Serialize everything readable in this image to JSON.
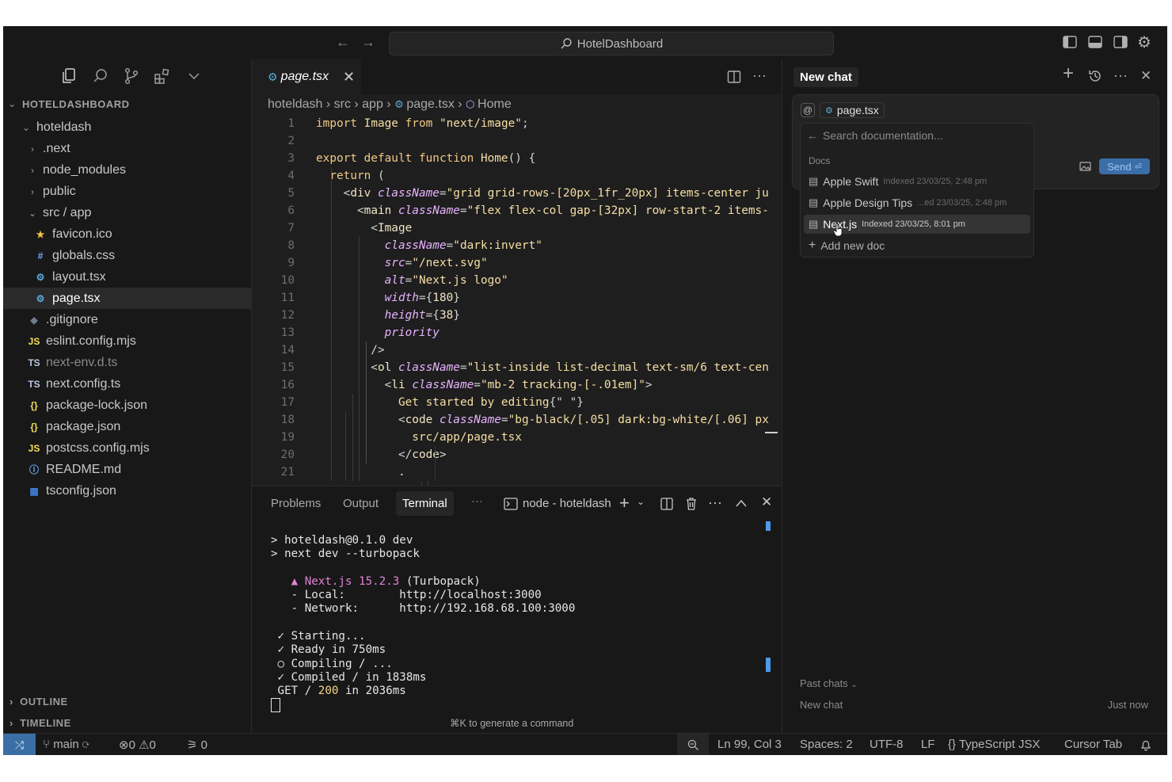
{
  "titlebar": {
    "search_label": "HotelDashboard",
    "back_icon": "arrow-left-icon",
    "forward_icon": "arrow-right-icon"
  },
  "sidebar": {
    "root_label": "HOTELDASHBOARD",
    "tree": [
      {
        "label": "hoteldash",
        "type": "folder-open",
        "indent": 1
      },
      {
        "label": ".next",
        "type": "folder",
        "indent": 2
      },
      {
        "label": "node_modules",
        "type": "folder",
        "indent": 2
      },
      {
        "label": "public",
        "type": "folder",
        "indent": 2
      },
      {
        "label": "src / app",
        "type": "folder-open",
        "indent": 2
      },
      {
        "label": "favicon.ico",
        "icon": "★",
        "color": "#f5c542",
        "indent": 3
      },
      {
        "label": "globals.css",
        "icon": "#",
        "color": "#6fb0ff",
        "indent": 3
      },
      {
        "label": "layout.tsx",
        "icon": "⚙",
        "color": "#5fa8d3",
        "indent": 3
      },
      {
        "label": "page.tsx",
        "icon": "⚙",
        "color": "#5fa8d3",
        "indent": 3,
        "selected": true
      },
      {
        "label": ".gitignore",
        "icon": "◆",
        "color": "#6e7b8a",
        "indent": 2
      },
      {
        "label": "eslint.config.mjs",
        "icon": "JS",
        "color": "#f5de5a",
        "indent": 2
      },
      {
        "label": "next-env.d.ts",
        "icon": "TS",
        "color": "#b8c7e0",
        "indent": 2,
        "dim": true
      },
      {
        "label": "next.config.ts",
        "icon": "TS",
        "color": "#b8c7e0",
        "indent": 2
      },
      {
        "label": "package-lock.json",
        "icon": "{}",
        "color": "#f5de5a",
        "indent": 2
      },
      {
        "label": "package.json",
        "icon": "{}",
        "color": "#f5de5a",
        "indent": 2
      },
      {
        "label": "postcss.config.mjs",
        "icon": "JS",
        "color": "#f5de5a",
        "indent": 2
      },
      {
        "label": "README.md",
        "icon": "ⓘ",
        "color": "#6fb0ff",
        "indent": 2
      },
      {
        "label": "tsconfig.json",
        "icon": "▦",
        "color": "#3f7fd8",
        "indent": 2
      }
    ],
    "outline_label": "OUTLINE",
    "timeline_label": "TIMELINE"
  },
  "editor": {
    "tab_label": "page.tsx",
    "breadcrumb": [
      "hoteldash",
      "src",
      "app",
      "page.tsx",
      "Home"
    ],
    "lines": [
      [
        [
          "kw",
          "import "
        ],
        [
          "fn",
          "Image "
        ],
        [
          "kw",
          "from "
        ],
        [
          "str",
          "\"next/image\""
        ],
        [
          "punc",
          ";"
        ]
      ],
      [],
      [
        [
          "kw",
          "export default function "
        ],
        [
          "fn",
          "Home"
        ],
        [
          "punc",
          "() {"
        ]
      ],
      [
        [
          "kw",
          "  return "
        ],
        [
          "punc",
          "("
        ]
      ],
      [
        [
          "punc",
          "    <"
        ],
        [
          "tag",
          "div "
        ],
        [
          "attr",
          "className"
        ],
        [
          "punc",
          "="
        ],
        [
          "str",
          "\"grid grid-rows-[20px_1fr_20px] items-center ju"
        ]
      ],
      [
        [
          "punc",
          "      <"
        ],
        [
          "tag",
          "main "
        ],
        [
          "attr",
          "className"
        ],
        [
          "punc",
          "="
        ],
        [
          "str",
          "\"flex flex-col gap-[32px] row-start-2 items-"
        ]
      ],
      [
        [
          "punc",
          "        <"
        ],
        [
          "tag",
          "Image"
        ]
      ],
      [
        [
          "attr",
          "          className"
        ],
        [
          "punc",
          "="
        ],
        [
          "str",
          "\"dark:invert\""
        ]
      ],
      [
        [
          "attr",
          "          src"
        ],
        [
          "punc",
          "="
        ],
        [
          "str",
          "\"/next.svg\""
        ]
      ],
      [
        [
          "attr",
          "          alt"
        ],
        [
          "punc",
          "="
        ],
        [
          "str",
          "\"Next.js logo\""
        ]
      ],
      [
        [
          "attr",
          "          width"
        ],
        [
          "punc",
          "={"
        ],
        [
          "num",
          "180"
        ],
        [
          "punc",
          "}"
        ]
      ],
      [
        [
          "attr",
          "          height"
        ],
        [
          "punc",
          "={"
        ],
        [
          "num",
          "38"
        ],
        [
          "punc",
          "}"
        ]
      ],
      [
        [
          "attr",
          "          priority"
        ]
      ],
      [
        [
          "punc",
          "        />"
        ]
      ],
      [
        [
          "punc",
          "        <"
        ],
        [
          "tag",
          "ol "
        ],
        [
          "attr",
          "className"
        ],
        [
          "punc",
          "="
        ],
        [
          "str",
          "\"list-inside list-decimal text-sm/6 text-cen"
        ]
      ],
      [
        [
          "punc",
          "          <"
        ],
        [
          "tag",
          "li "
        ],
        [
          "attr",
          "className"
        ],
        [
          "punc",
          "="
        ],
        [
          "str",
          "\"mb-2 tracking-[-.01em]\""
        ],
        [
          "punc",
          ">"
        ]
      ],
      [
        [
          "plain",
          "            Get started by editing"
        ],
        [
          "punc",
          "{\" \"}"
        ]
      ],
      [
        [
          "punc",
          "            <"
        ],
        [
          "tag",
          "code "
        ],
        [
          "attr",
          "className"
        ],
        [
          "punc",
          "="
        ],
        [
          "str",
          "\"bg-black/[.05] dark:bg-white/[.06] px"
        ]
      ],
      [
        [
          "plain",
          "              src/app/page.tsx"
        ]
      ],
      [
        [
          "punc",
          "            </"
        ],
        [
          "tag",
          "code"
        ],
        [
          "punc",
          ">"
        ]
      ],
      [
        [
          "plain",
          "            ."
        ]
      ]
    ]
  },
  "panel": {
    "tabs": [
      "Problems",
      "Output",
      "Terminal"
    ],
    "more": "···",
    "terminal_name": "node - hoteldash",
    "terminal_lines": [
      "> hoteldash@0.1.0 dev",
      "> next dev --turbopack",
      "",
      "   ▲ Next.js 15.2.3 (Turbopack)",
      "   - Local:        http://localhost:3000",
      "   - Network:      http://192.168.68.100:3000",
      "",
      " ✓ Starting...",
      " ✓ Ready in 750ms",
      " ○ Compiling / ...",
      " ✓ Compiled / in 1838ms",
      " GET / 200 in 2036ms"
    ],
    "hint": "⌘K to generate a command"
  },
  "chat": {
    "title": "New chat",
    "context_file": "page.tsx",
    "search_placeholder": "Search documentation...",
    "docs_header": "Docs",
    "docs": [
      {
        "name": "Apple Swift",
        "meta": "Indexed 23/03/25, 2:48 pm"
      },
      {
        "name": "Apple Design Tips",
        "meta": "...ed 23/03/25, 2:48 pm"
      },
      {
        "name": "Next.js",
        "meta": "Indexed 23/03/25, 8:01 pm",
        "highlight": true
      }
    ],
    "add_doc": "Add new doc",
    "send_label": "Send",
    "past_chats_label": "Past chats",
    "past_chats": [
      {
        "title": "New chat",
        "time": "Just now"
      }
    ]
  },
  "status": {
    "branch": "main",
    "errors": "0",
    "warnings": "0",
    "ports": "0",
    "position": "Ln 99, Col 3",
    "spaces": "Spaces: 2",
    "encoding": "UTF-8",
    "eol": "LF",
    "language": "TypeScript JSX",
    "extra": "Cursor Tab"
  },
  "colors": {
    "accent": "#4c9be8",
    "remote": "#3a6ea5"
  }
}
